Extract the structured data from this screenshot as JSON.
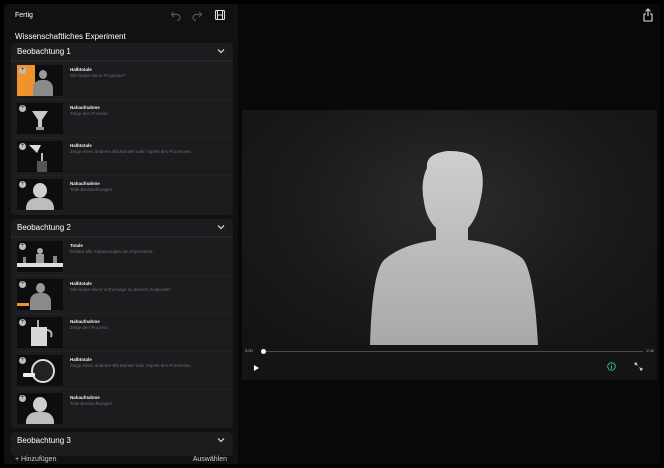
{
  "header": {
    "done_label": "Fertig",
    "title": "Wissenschaftliches Experiment"
  },
  "sections": [
    {
      "title": "Beobachtung 1",
      "items": [
        {
          "title": "Halbtotale",
          "subtitle": "Wie lautet deine Prognose?"
        },
        {
          "title": "Nahaufnahme",
          "subtitle": "Zeige den Prozess."
        },
        {
          "title": "Halbtotale",
          "subtitle": "Zeige einen anderen Blickwinkel oder Aspekt des Prozesses."
        },
        {
          "title": "Nahaufnahme",
          "subtitle": "Teile Beobachtungen."
        }
      ]
    },
    {
      "title": "Beobachtung 2",
      "items": [
        {
          "title": "Totale",
          "subtitle": "Erkläre alle Anpassungen am Experiment."
        },
        {
          "title": "Halbtotale",
          "subtitle": "Wie lautet deine Vorhersage zu diesem Zeitpunkt?"
        },
        {
          "title": "Nahaufnahme",
          "subtitle": "Zeige den Prozess."
        },
        {
          "title": "Halbtotale",
          "subtitle": "Zeige einen anderen Blickwinkel oder Aspekt des Prozesses."
        },
        {
          "title": "Nahaufnahme",
          "subtitle": "Teile Beobachtungen."
        }
      ]
    },
    {
      "title": "Beobachtung 3",
      "items": []
    }
  ],
  "footer": {
    "add_label": "Hinzufügen",
    "select_label": "Auswählen"
  },
  "player": {
    "current_time": "0:00",
    "duration": "2:11",
    "progress": 0.0
  },
  "icons": {
    "undo": "undo-icon",
    "redo": "redo-icon",
    "film": "film-icon",
    "share": "share-icon",
    "play": "play-icon",
    "info": "info-icon",
    "expand": "expand-icon"
  },
  "colors": {
    "accent": "#2fc3a8",
    "orange": "#f2922d"
  }
}
